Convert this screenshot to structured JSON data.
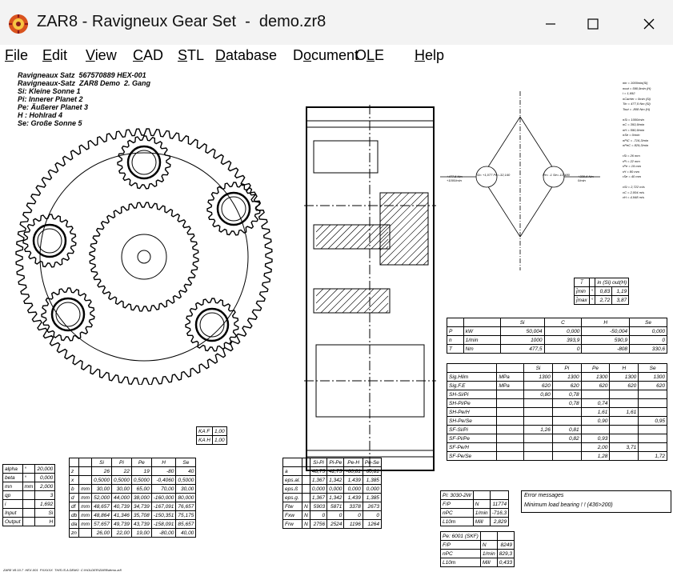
{
  "window": {
    "title": "ZAR8 - Ravigneux Gear Set  -  demo.zr8",
    "icon": "gear-app-icon",
    "controls": [
      "minimize-icon",
      "maximize-icon",
      "close-icon"
    ]
  },
  "menu": [
    {
      "key": "F",
      "rest": "ile"
    },
    {
      "key": "E",
      "rest": "dit"
    },
    {
      "key": "V",
      "rest": "iew"
    },
    {
      "key": "C",
      "rest": "AD"
    },
    {
      "key": "S",
      "rest": "TL"
    },
    {
      "key": "D",
      "rest": "atabase"
    },
    {
      "pre": "D",
      "key": "o",
      "rest": "cument"
    },
    {
      "pre": "O",
      "key": "L",
      "rest": "E"
    },
    {
      "key": "H",
      "rest": "elp"
    }
  ],
  "header_lines": [
    "Ravigneaux Satz  567570889 HEX-001",
    "Ravigneaux-Satz  ZAR8 Demo  2. Gang",
    "Si: Kleine Sonne 1",
    "Pi: Innerer Planet 2",
    "Pe: Äußerer Planet 3",
    "H : Hohlrad 4",
    "Se: Große Sonne 5"
  ],
  "ratio_table": {
    "head": [
      "i̅",
      "",
      "in (Si) out(H)"
    ],
    "rows": [
      [
        "j̄min",
        "°",
        "0,83",
        "1,19"
      ],
      [
        "j̄max",
        "°",
        "2,72",
        "3,87"
      ]
    ]
  },
  "power_table": {
    "head": [
      "",
      "",
      "Si",
      "C",
      "H",
      "Se"
    ],
    "rows": [
      [
        "P",
        "kW",
        "50,004",
        "0,000",
        "-50,004",
        "0,000"
      ],
      [
        "n",
        "1/min",
        "1000",
        "393,9",
        "590,9",
        "0"
      ],
      [
        "T",
        "Nm",
        "477,5",
        "0",
        "-808",
        "330,6"
      ]
    ]
  },
  "safety_table": {
    "head": [
      "",
      "",
      "Si",
      "Pi",
      "Pe",
      "H",
      "Se"
    ],
    "rows": [
      [
        "Sig.Hlim",
        "MPa",
        "1300",
        "1300",
        "1300",
        "1300",
        "1300"
      ],
      [
        "Sig.F.E",
        "MPa",
        "620",
        "620",
        "620",
        "620",
        "620"
      ],
      [
        "SH-Si/Pi",
        "",
        "0,80",
        "0,78",
        "",
        "",
        ""
      ],
      [
        "SH-Pi/Pe",
        "",
        "",
        "0,78",
        "0,74",
        "",
        ""
      ],
      [
        "SH-Pe/H",
        "",
        "",
        "",
        "1,61",
        "1,61",
        ""
      ],
      [
        "SH-Pe/Se",
        "",
        "",
        "",
        "0,90",
        "",
        "0,95"
      ],
      [
        "SF-Si/Pi",
        "",
        "1,26",
        "0,81",
        "",
        "",
        ""
      ],
      [
        "SF-Pi/Pe",
        "",
        "",
        "0,82",
        "0,93",
        "",
        ""
      ],
      [
        "SF-Pe/H",
        "",
        "",
        "",
        "2,00",
        "3,71",
        ""
      ],
      [
        "SF-Pe/Se",
        "",
        "",
        "",
        "1,28",
        "",
        "1,72"
      ]
    ]
  },
  "ka_table": [
    [
      "KA F",
      "1,00"
    ],
    [
      "KA H",
      "1,00"
    ]
  ],
  "left_table": [
    [
      "alpha",
      "°",
      "20,000"
    ],
    [
      "beta",
      "°",
      "0,000"
    ],
    [
      "mn",
      "mm",
      "2,000"
    ],
    [
      "qp",
      "",
      "3"
    ],
    [
      "i",
      "",
      "1,692"
    ],
    [
      "Input",
      "",
      "Si"
    ],
    [
      "Output",
      "",
      "H"
    ]
  ],
  "gear_table": {
    "head": [
      "",
      "",
      "Si",
      "Pi",
      "Pe",
      "H",
      "Se"
    ],
    "rows": [
      [
        "z",
        "",
        "26",
        "22",
        "19",
        "-80",
        "40"
      ],
      [
        "x",
        "",
        "0,5000",
        "0,5000",
        "0,5000",
        "-0,4060",
        "0,5000"
      ],
      [
        "b",
        "mm",
        "30,00",
        "30,00",
        "65,00",
        "70,00",
        "30,00"
      ],
      [
        "d",
        "mm",
        "52,000",
        "44,000",
        "38,000",
        "-160,000",
        "80,000"
      ],
      [
        "df",
        "mm",
        "48,657",
        "40,739",
        "34,739",
        "-167,091",
        "76,657"
      ],
      [
        "db",
        "mm",
        "48,864",
        "41,346",
        "35,708",
        "-150,351",
        "75,175"
      ],
      [
        "da",
        "mm",
        "57,657",
        "49,739",
        "43,739",
        "-158,091",
        "85,657"
      ],
      [
        "zn",
        "",
        "26,00",
        "22,00",
        "19,00",
        "-80,00",
        "40,00"
      ]
    ]
  },
  "mesh_table": {
    "head": [
      "",
      "",
      "Si-Pi",
      "Pi-Pe",
      "Pe-H",
      "Pe-Se"
    ],
    "rows": [
      [
        "a",
        "",
        "48,75",
        "42,75",
        "-60,81",
        "60,81"
      ],
      [
        "eps.al.",
        "",
        "1,367",
        "1,342",
        "1,439",
        "1,385"
      ],
      [
        "eps.ß",
        "",
        "0,000",
        "0,000",
        "0,000",
        "0,000"
      ],
      [
        "eps.g.",
        "",
        "1,367",
        "1,342",
        "1,439",
        "1,385"
      ],
      [
        "Ftw",
        "N",
        "5903",
        "5871",
        "3378",
        "2673"
      ],
      [
        "Fxw",
        "N",
        "0",
        "0",
        "0",
        "0"
      ],
      [
        "Frw",
        "N",
        "2756",
        "2524",
        "1196",
        "1264"
      ]
    ]
  },
  "bearing1": {
    "title": "Pi: 3030-2W",
    "rows": [
      [
        "F/P",
        "N",
        "11774"
      ],
      [
        "nPC",
        "1/min",
        "-716,3"
      ],
      [
        "L10m",
        "Mill",
        "2,829"
      ]
    ]
  },
  "bearing2": {
    "title": "Pe: 6001 (SKF)",
    "rows": [
      [
        "F/P",
        "N",
        "8249"
      ],
      [
        "nPC",
        "1/min",
        "829,3"
      ],
      [
        "L10m",
        "Mill",
        "0,433"
      ]
    ]
  },
  "error_box": {
    "title": "Error messages",
    "message": "Minimum load bearing ! ! (436>200)"
  },
  "footer": "ZAR8 V8.10.7  HEX-001  PXXXXX  THIS IS A DEMO  C:\\HOLDER\\ZAR8\\demo.zr8",
  "flow_labels": {
    "left_node": "Si= +1,077 Pe=-32,140",
    "right_node": "Pe= -1 Se=-12,480",
    "left_in": "+477,5 Nm\n+1000/min",
    "right_out": "+330,6 Nm\n0/min"
  },
  "side_notes": [
    "nin = 1000min(Si)",
    "nout = 590,9min (H)",
    "i = 1,692",
    "nCarrier = 0min (Si)",
    "Tin = 477,5 Nm (Si)",
    "Tout = -808 Nm (H)",
    "",
    "nSi = 1000/min",
    "nC = 393,9/min",
    "nH = 590,9/min",
    "nSe = 0/min",
    "nPiC = -716,3/min",
    "nPeC = 829,3/min",
    "",
    "rSi = 26 mm",
    "rPi = 22 mm",
    "rPe = 19 mm",
    "rH = 80 mm",
    "rSe = 40 mm",
    "",
    "vSi = 2,722 m/s",
    "vC = 2,004 m/s",
    "vH = 4,948 m/s"
  ]
}
